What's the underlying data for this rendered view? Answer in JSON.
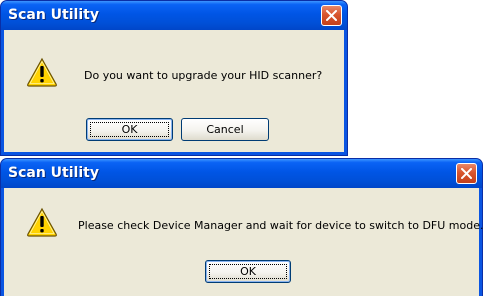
{
  "dialogs": [
    {
      "title": "Scan Utility",
      "message": "Do you want to upgrade your HID scanner?",
      "icon": "warning-icon",
      "buttons": {
        "ok": "OK",
        "cancel": "Cancel"
      }
    },
    {
      "title": "Scan Utility",
      "message": "Please check Device Manager and wait for device to switch to DFU mode.",
      "icon": "warning-icon",
      "buttons": {
        "ok": "OK"
      }
    }
  ],
  "colors": {
    "titlebar": "#0055e5",
    "client_background": "#ece9d8",
    "close_button": "#d8552e",
    "warning_yellow": "#ffd200"
  }
}
